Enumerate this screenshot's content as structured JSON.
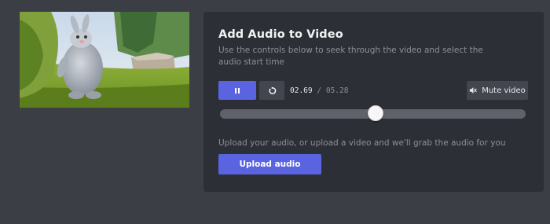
{
  "video": {
    "icon": "video-preview-image"
  },
  "panel": {
    "title": "Add Audio to Video",
    "description": "Use the controls below to seek through the video and select the audio start time"
  },
  "controls": {
    "play_pause_icon": "pause-icon",
    "restart_icon": "restart-icon",
    "current_time": "02.69",
    "time_separator": "/",
    "duration": "05.28",
    "mute_label": "Mute video",
    "mute_icon": "speaker-muted-icon"
  },
  "seek": {
    "progress": 0.5095
  },
  "upload": {
    "hint": "Upload your audio, or upload a video and we'll grab the audio for you",
    "button_label": "Upload audio"
  },
  "colors": {
    "background": "#3b3e45",
    "panel": "#2c2f36",
    "accent": "#5b64e0",
    "secondary_button": "#43464e",
    "track": "#5f626a"
  }
}
